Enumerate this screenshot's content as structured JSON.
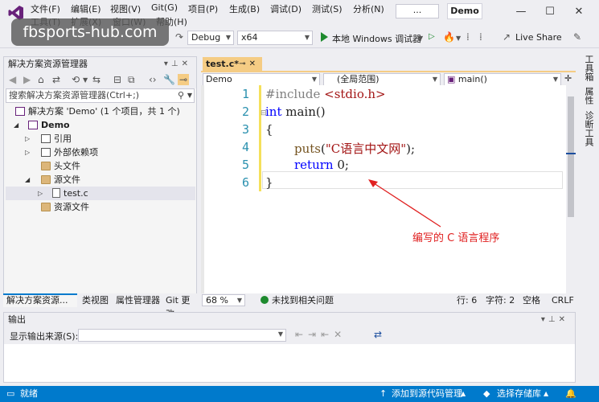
{
  "watermark": "fbsports-hub.com",
  "menu": {
    "row1": [
      "文件(F)",
      "编辑(E)",
      "视图(V)",
      "Git(G)",
      "项目(P)",
      "生成(B)",
      "调试(D)",
      "测试(S)",
      "分析(N)"
    ],
    "row2": [
      "工具(T)",
      "扩展(X)",
      "窗口(W)",
      "帮助(H)"
    ],
    "search": "...",
    "solution_badge": "Demo"
  },
  "window_controls": {
    "minimize": "—",
    "maximize": "☐",
    "close": "✕"
  },
  "toolbar": {
    "config": "Debug",
    "platform": "x64",
    "run_label": "本地 Windows 调试器",
    "live_share": "Live Share"
  },
  "solution_explorer": {
    "title": "解决方案资源管理器",
    "search_placeholder": "搜索解决方案资源管理器(Ctrl+;)",
    "tree": [
      {
        "label": "解决方案 'Demo' (1 个项目，共 1 个)"
      },
      {
        "label": "Demo"
      },
      {
        "label": "引用"
      },
      {
        "label": "外部依赖项"
      },
      {
        "label": "头文件"
      },
      {
        "label": "源文件"
      },
      {
        "label": "test.c"
      },
      {
        "label": "资源文件"
      }
    ],
    "bottom_tabs": [
      "解决方案资源...",
      "类视图",
      "属性管理器",
      "Git 更改"
    ]
  },
  "editor": {
    "tab": "test.c*",
    "nav": {
      "project": "Demo",
      "scope": "(全局范围)",
      "member": "main()"
    },
    "lines": [
      {
        "num": "1"
      },
      {
        "num": "2"
      },
      {
        "num": "3"
      },
      {
        "num": "4"
      },
      {
        "num": "5"
      },
      {
        "num": "6"
      }
    ],
    "code": {
      "l1_pp": "#include ",
      "l1_hdr": "<stdio.h>",
      "l2_kw": "int",
      "l2_rest": " main()",
      "l3": "{",
      "l4_fn": "puts",
      "l4_open": "(",
      "l4_str": "\"C语言中文网\"",
      "l4_close": ");",
      "l5_kw": "return",
      "l5_rest": " 0;",
      "l6": "}"
    },
    "annotation": "编写的 C 语言程序",
    "status": {
      "zoom": "68 %",
      "issues": "未找到相关问题",
      "line": "行: 6",
      "char": "字符: 2",
      "spaces": "空格",
      "eol": "CRLF"
    }
  },
  "right_strip": [
    "工具箱",
    "属性",
    "诊断工具"
  ],
  "output": {
    "title": "输出",
    "source_label": "显示输出来源(S):"
  },
  "statusbar": {
    "ready": "就绪",
    "add_source": "添加到源代码管理",
    "select_repo": "选择存储库"
  },
  "colors": {
    "accent": "#007acc",
    "tab_active": "#f5cc84",
    "annotation": "#e02020",
    "keyword": "#0000ff",
    "string": "#a31515"
  }
}
